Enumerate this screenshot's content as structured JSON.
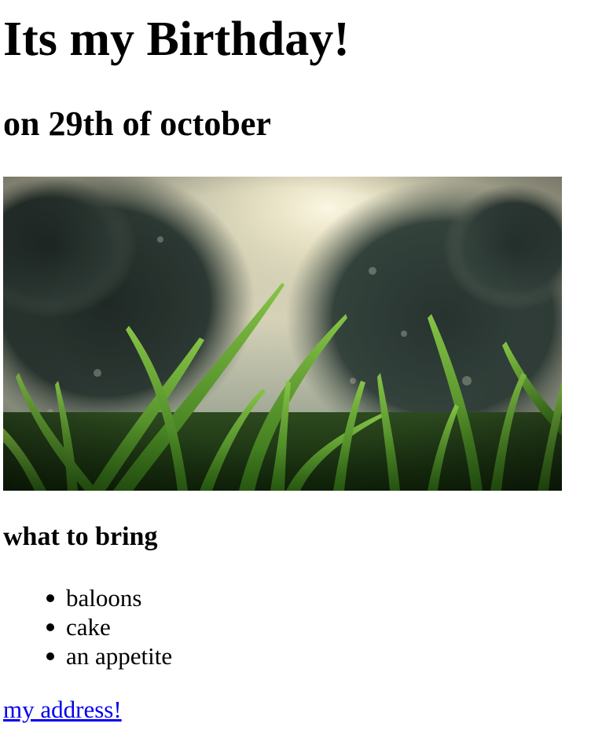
{
  "page": {
    "title": "Its my Birthday!",
    "subtitle": "on 29th of october"
  },
  "hero_image": {
    "subject": "grass-blades-trees-sun-photo",
    "colors": {
      "sky": "#c9c6ae",
      "sun": "#f4efd8",
      "trees": "#27332f",
      "grass_dark": "#1c3a12",
      "grass_mid": "#3f7a1f",
      "grass_light": "#7dbb3b"
    }
  },
  "bring_section": {
    "heading": "what to bring",
    "items": [
      {
        "label": "baloons"
      },
      {
        "label": "cake"
      },
      {
        "label": "an appetite"
      }
    ]
  },
  "footer": {
    "address_link_label": "my address!",
    "link_color": "#0000ee"
  }
}
